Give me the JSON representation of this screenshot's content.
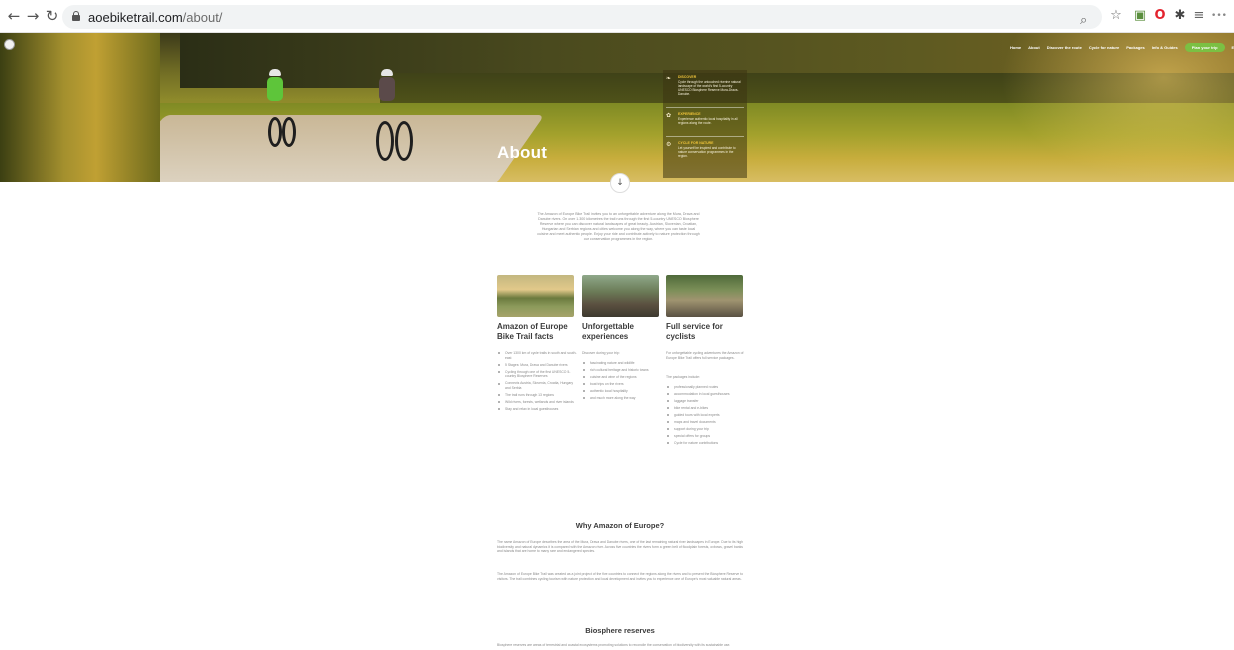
{
  "browser": {
    "url_host": "aoebiketrail.com",
    "url_path": "/about/",
    "icons": [
      "back-icon",
      "forward-icon",
      "reload-icon",
      "lock-icon",
      "zoom-icon",
      "star-icon",
      "extension-icon",
      "opera-icon",
      "puzzle-icon",
      "playlist-icon",
      "profile-icon"
    ]
  },
  "site": {
    "nav": [
      "Home",
      "About",
      "Discover the route",
      "Cycle for nature",
      "Packages",
      "Info & Guides"
    ],
    "cta": "Plan your trip",
    "lang": "EN"
  },
  "hero": {
    "title": "About",
    "features": [
      {
        "title": "DISCOVER",
        "text": "Cycle through the untouched riverine natural landscape of the world's first 5-country UNESCO Biosphere Reserve Mura-Drava-Danube."
      },
      {
        "title": "EXPERIENCE",
        "text": "Experience authentic local hospitality in all regions along the route."
      },
      {
        "title": "CYCLE FOR NATURE",
        "text": "Let yourself be inspired and contribute to nature conservation programmes in the region."
      }
    ]
  },
  "intro": "The Amazon of Europe Bike Trail invites you to an unforgettable adventure along the Mura, Drava and Danube rivers. On over 1.300 kilometres the trail runs through the first 5-country UNESCO Biosphere Reserve where you can discover natural landscapes of great beauty. Austrian, Slovenian, Croatian, Hungarian and Serbian regions and cities welcome you along the way, where you can taste local cuisine and meet authentic people. Enjoy your ride and contribute actively to nature protection through our conservation programmes in the region.",
  "cards": [
    {
      "title": "Amazon of Europe Bike Trail facts",
      "items": [
        "Over 1300 km of cycle trails in south and south-east",
        "5 Stages: Mura, Drava and Danube rivers",
        "Cycling through one of the first UNESCO 5-country Biosphere Reserves",
        "Connects Austria, Slovenia, Croatia, Hungary and Serbia",
        "The trail runs through 13 regions",
        "Wild rivers, forests, wetlands and river islands",
        "Stay and relax in local guesthouses"
      ]
    },
    {
      "title": "Unforgettable experiences",
      "intro": "Discover during your trip:",
      "items": [
        "fascinating nature and wildlife",
        "rich cultural heritage and historic towns",
        "cuisine and wine of the regions",
        "boat trips on the rivers",
        "authentic local hospitality",
        "and much more along the way"
      ]
    },
    {
      "title": "Full service for cyclists",
      "intro": "For unforgettable cycling adventures the Amazon of Europe Bike Trail offers full service packages.",
      "intro2": "The packages include:",
      "items": [
        "professionally planned routes",
        "accommodation in local guesthouses",
        "luggage transfer",
        "bike rental and e-bikes",
        "guided tours with local experts",
        "maps and travel documents",
        "support during your trip",
        "special offers for groups",
        "Cycle for nature contributions"
      ]
    }
  ],
  "sections": [
    {
      "title": "Why Amazon of Europe?",
      "paragraphs": [
        "The name Amazon of Europe describes the area of the Mura, Drava and Danube rivers, one of the last remaining natural river landscapes in Europe. Due to its high biodiversity and natural dynamics it is compared with the Amazon river. Across five countries the rivers form a green belt of floodplain forests, oxbows, gravel banks and islands that are home to many rare and endangered species.",
        "The Amazon of Europe Bike Trail was created as a joint project of the five countries to connect the regions along the rivers and to present the Biosphere Reserve to visitors. The trail combines cycling tourism with nature protection and local development and invites you to experience one of Europe's most valuable natural areas."
      ]
    },
    {
      "title": "Biosphere reserves",
      "paragraphs": [
        "Biosphere reserves are areas of terrestrial and coastal ecosystems promoting solutions to reconcile the conservation of biodiversity with its sustainable use."
      ]
    }
  ],
  "colors": {
    "accent": "#7bc043",
    "feature_title": "#f0c43a",
    "text": "#8a8a8a",
    "heading": "#3b3b3b"
  }
}
